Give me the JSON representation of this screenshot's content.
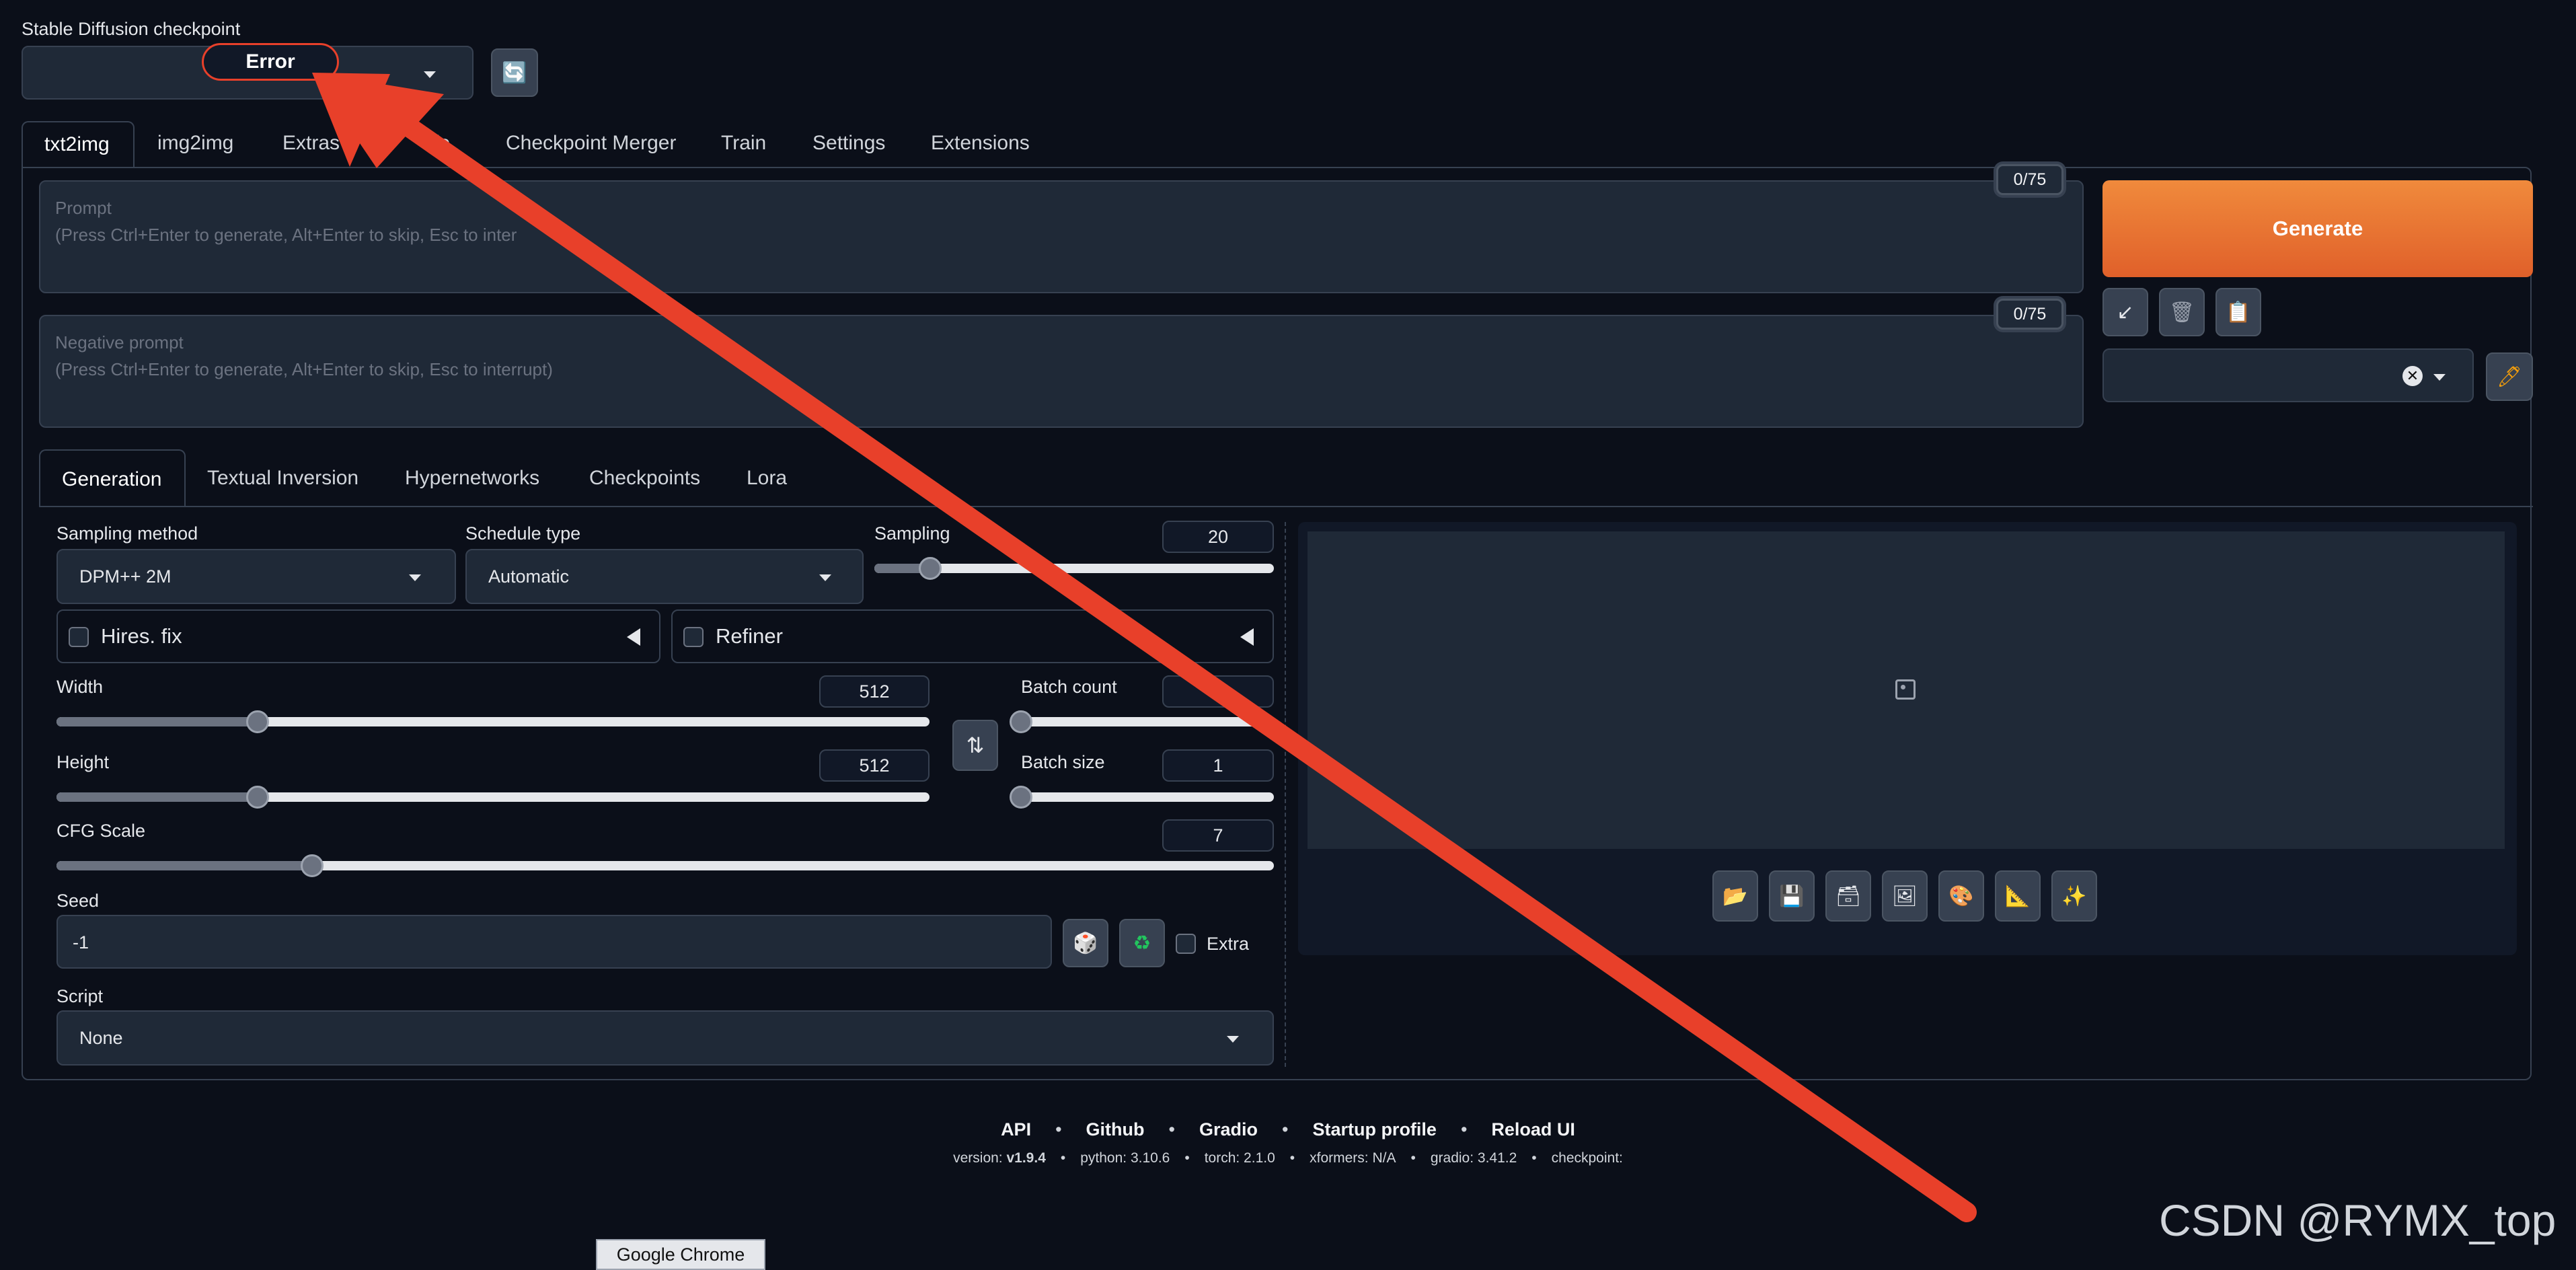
{
  "checkpoint": {
    "label": "Stable Diffusion checkpoint",
    "error_text": "Error"
  },
  "main_tabs": [
    "txt2img",
    "img2img",
    "Extras",
    "fo",
    "Checkpoint Merger",
    "Train",
    "Settings",
    "Extensions"
  ],
  "prompt": {
    "label": "Prompt",
    "hint": "(Press Ctrl+Enter to generate, Alt+Enter to skip, Esc to inter",
    "counter": "0/75"
  },
  "negative_prompt": {
    "label": "Negative prompt",
    "hint": "(Press Ctrl+Enter to generate, Alt+Enter to skip, Esc to interrupt)",
    "counter": "0/75"
  },
  "generate": {
    "label": "Generate",
    "color": "#e8672a"
  },
  "sub_tabs": [
    "Generation",
    "Textual Inversion",
    "Hypernetworks",
    "Checkpoints",
    "Lora"
  ],
  "sampling_method": {
    "label": "Sampling method",
    "value": "DPM++ 2M"
  },
  "schedule_type": {
    "label": "Schedule type",
    "value": "Automatic"
  },
  "sampling_steps": {
    "label": "Sampling ",
    "value": "20",
    "fraction": 0.14
  },
  "hires_fix": {
    "label": "Hires. fix"
  },
  "refiner": {
    "label": "Refiner"
  },
  "width": {
    "label": "Width",
    "value": "512",
    "fraction": 0.23
  },
  "height": {
    "label": "Height",
    "value": "512",
    "fraction": 0.23
  },
  "batch_count": {
    "label": "Batch count",
    "value": "",
    "fraction": 0
  },
  "batch_size": {
    "label": "Batch size",
    "value": "1",
    "fraction": 0
  },
  "cfg_scale": {
    "label": "CFG Scale",
    "value": "7",
    "fraction": 0.21
  },
  "seed": {
    "label": "Seed",
    "value": "-1",
    "extra_label": "Extra"
  },
  "script": {
    "label": "Script",
    "value": "None"
  },
  "gallery_tools": [
    "folder-icon",
    "save-icon",
    "zip-icon",
    "image-icon",
    "palette-icon",
    "ruler-icon",
    "sparkle-icon"
  ],
  "footer": {
    "links": [
      "API",
      "Github",
      "Gradio",
      "Startup profile",
      "Reload UI"
    ],
    "version_label": "version:",
    "version_value": "v1.9.4",
    "python": "python: 3.10.6",
    "torch": "torch: 2.1.0",
    "xformers": "xformers: N/A",
    "gradio": "gradio: 3.41.2",
    "checkpoint": "checkpoint:"
  },
  "taskbar_tooltip": "Google Chrome",
  "watermark": "CSDN @RYMX_top",
  "arrow_color": "#e8402a"
}
